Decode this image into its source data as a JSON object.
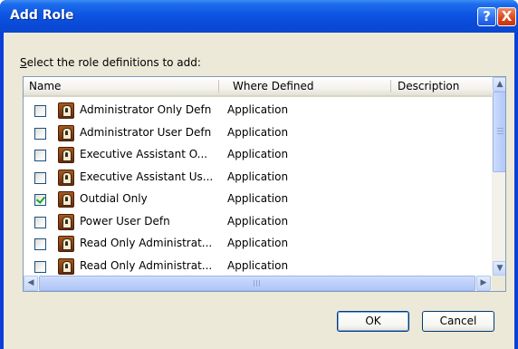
{
  "window": {
    "title": "Add Role",
    "help_label": "?",
    "close_label": "X"
  },
  "prompt": {
    "mnemonic": "S",
    "rest": "elect the role definitions to add:"
  },
  "table": {
    "columns": [
      "Name",
      "Where Defined",
      "Description"
    ],
    "rows": [
      {
        "name": "Administrator Only Defn",
        "where": "Application",
        "description": "",
        "checked": false
      },
      {
        "name": "Administrator User Defn",
        "where": "Application",
        "description": "",
        "checked": false
      },
      {
        "name": "Executive Assistant O...",
        "where": "Application",
        "description": "",
        "checked": false
      },
      {
        "name": "Executive Assistant Us...",
        "where": "Application",
        "description": "",
        "checked": false
      },
      {
        "name": "Outdial Only",
        "where": "Application",
        "description": "",
        "checked": true
      },
      {
        "name": "Power User Defn",
        "where": "Application",
        "description": "",
        "checked": false
      },
      {
        "name": "Read Only Administrat...",
        "where": "Application",
        "description": "",
        "checked": false
      },
      {
        "name": "Read Only Administrat...",
        "where": "Application",
        "description": "",
        "checked": false
      }
    ]
  },
  "scrollbar": {
    "up_glyph": "▲",
    "down_glyph": "▼",
    "left_glyph": "◀",
    "right_glyph": "▶"
  },
  "buttons": {
    "ok_label": "OK",
    "cancel_label": "Cancel"
  }
}
